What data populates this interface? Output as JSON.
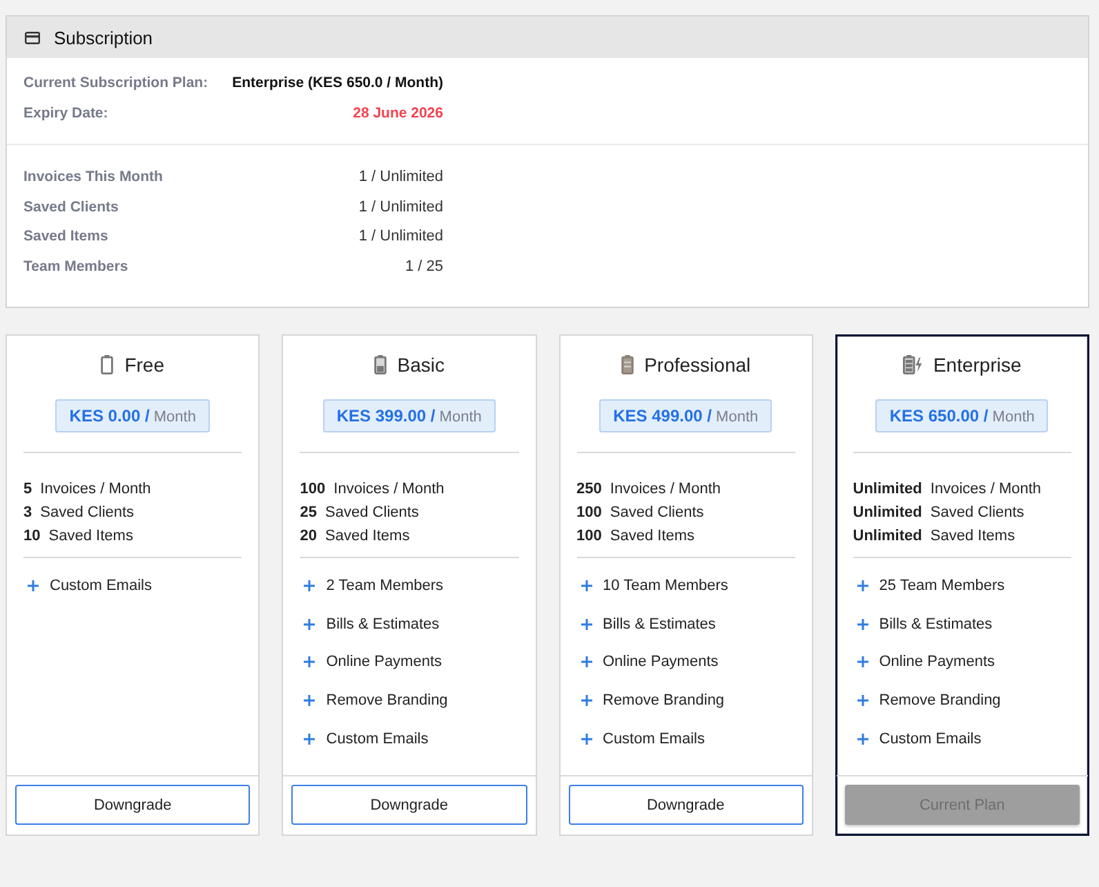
{
  "header": {
    "title": "Subscription"
  },
  "current_plan": {
    "label": "Current Subscription Plan:",
    "value": "Enterprise (KES 650.0 / Month)"
  },
  "expiry_date": {
    "label": "Expiry Date:",
    "value": "28 June 2026"
  },
  "usage": [
    {
      "label": "Invoices This Month",
      "value": "1 / Unlimited"
    },
    {
      "label": "Saved Clients",
      "value": "1 / Unlimited"
    },
    {
      "label": "Saved Items",
      "value": "1 / Unlimited"
    },
    {
      "label": "Team Members",
      "value": "1 / 25"
    }
  ],
  "plans": [
    {
      "name": "Free",
      "kind": "empty",
      "price": "**KES 0.00 /** Month",
      "selected": false,
      "limits": [
        "**5** Invoices / Month",
        "**3** Saved Clients",
        "**10** Saved Items"
      ],
      "features": [
        "Custom Emails"
      ],
      "button": {
        "label": "Downgrade",
        "disabled": false
      }
    },
    {
      "name": "Basic",
      "kind": "low",
      "price": "**KES 399.00 /** Month",
      "selected": false,
      "limits": [
        "**100** Invoices / Month",
        "**25** Saved Clients",
        "**20** Saved Items"
      ],
      "features": [
        "2 Team Members",
        "Bills & Estimates",
        "Online Payments",
        "Remove Branding",
        "Custom Emails"
      ],
      "button": {
        "label": "Downgrade",
        "disabled": false
      }
    },
    {
      "name": "Professional",
      "kind": "full",
      "price": "**KES 499.00 /** Month",
      "selected": false,
      "limits": [
        "**250** Invoices / Month",
        "**100** Saved Clients",
        "**100** Saved Items"
      ],
      "features": [
        "10 Team Members",
        "Bills & Estimates",
        "Online Payments",
        "Remove Branding",
        "Custom Emails"
      ],
      "button": {
        "label": "Downgrade",
        "disabled": false
      }
    },
    {
      "name": "Enterprise",
      "kind": "charging",
      "price": "**KES 650.00 /** Month",
      "selected": true,
      "limits": [
        "**Unlimited** Invoices / Month",
        "**Unlimited** Saved Clients",
        "**Unlimited** Saved Items"
      ],
      "features": [
        "25 Team Members",
        "Bills & Estimates",
        "Online Payments",
        "Remove Branding",
        "Custom Emails"
      ],
      "button": {
        "label": "Current Plan",
        "disabled": true
      }
    }
  ]
}
